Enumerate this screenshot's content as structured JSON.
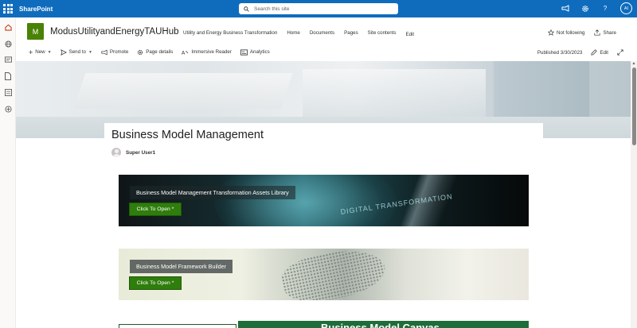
{
  "suite_bar": {
    "app_name": "SharePoint",
    "search_placeholder": "Search this site",
    "user_initials": "AI",
    "icons": [
      "app-launcher-icon",
      "megaphone-icon",
      "gear-icon",
      "help-icon"
    ]
  },
  "left_rail": {
    "icons": [
      "home-icon",
      "globe-icon",
      "news-icon",
      "document-icon",
      "list-icon",
      "add-icon"
    ]
  },
  "site": {
    "logo_letter": "M",
    "logo_color": "#498205",
    "title": "ModusUtilityandEnergyTAUHub",
    "nav": [
      "Utility and Energy Business Transformation",
      "Home",
      "Documents",
      "Pages",
      "Site contents"
    ],
    "nav_edit": "Edit",
    "follow_label": "Not following",
    "share_label": "Share"
  },
  "command_bar": {
    "new_label": "New",
    "send_to_label": "Send to",
    "promote_label": "Promote",
    "page_details_label": "Page details",
    "immersive_reader_label": "Immersive Reader",
    "analytics_label": "Analytics",
    "published_label": "Published 3/30/2023",
    "edit_label": "Edit"
  },
  "page": {
    "title": "Business Model Management",
    "author": "Super User1"
  },
  "tiles": [
    {
      "label": "Business Model Management Transformation Assets Library",
      "button": "Click To Open *",
      "bg_text": "DIGITAL TRANSFORMATION"
    },
    {
      "label": "Business Model Framework Builder",
      "button": "Click To Open *"
    }
  ],
  "bottom_tile": {
    "text": "Business Model Canvas"
  },
  "colors": {
    "suite_blue": "#0f6cbd",
    "button_green": "#2f7d0c",
    "bottom_green": "#1f6d3a"
  }
}
